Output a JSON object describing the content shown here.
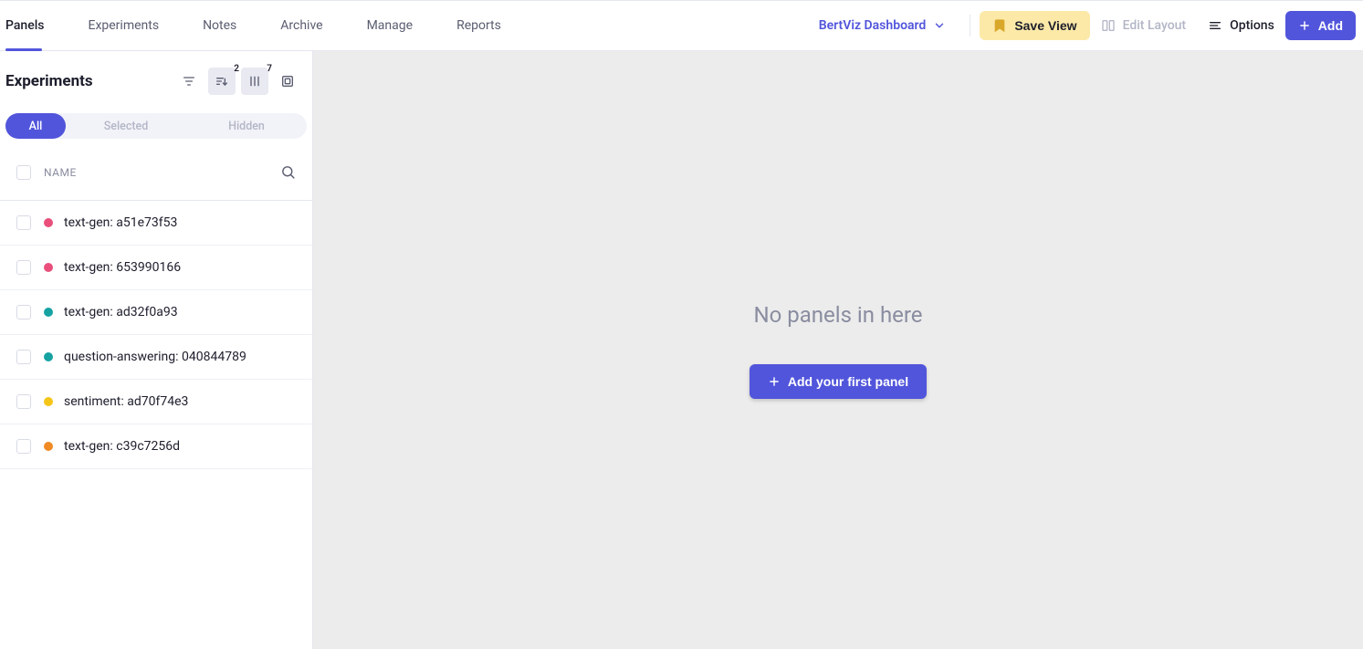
{
  "topnav": {
    "items": [
      {
        "label": "Panels",
        "id": "panels",
        "active": true
      },
      {
        "label": "Experiments",
        "id": "experiments",
        "active": false
      },
      {
        "label": "Notes",
        "id": "notes",
        "active": false
      },
      {
        "label": "Archive",
        "id": "archive",
        "active": false
      },
      {
        "label": "Manage",
        "id": "manage",
        "active": false
      },
      {
        "label": "Reports",
        "id": "reports",
        "active": false
      }
    ]
  },
  "dashboard": {
    "name": "BertViz Dashboard"
  },
  "actions": {
    "save_view": "Save View",
    "edit_layout": "Edit Layout",
    "options": "Options",
    "add": "Add"
  },
  "sidebar": {
    "title": "Experiments",
    "sort_badge": "2",
    "columns_badge": "7",
    "segments": {
      "all": "All",
      "selected": "Selected",
      "hidden": "Hidden"
    },
    "list_header": "NAME",
    "experiments": [
      {
        "name": "text-gen: a51e73f53",
        "color": "#e94f7a"
      },
      {
        "name": "text-gen: 653990166",
        "color": "#e94f7a"
      },
      {
        "name": "text-gen: ad32f0a93",
        "color": "#17a2a2"
      },
      {
        "name": "question-answering: 040844789",
        "color": "#17a2a2"
      },
      {
        "name": "sentiment: ad70f74e3",
        "color": "#f5c518"
      },
      {
        "name": "text-gen: c39c7256d",
        "color": "#f08a24"
      }
    ]
  },
  "main": {
    "empty_message": "No panels in here",
    "add_panel_button": "Add your first panel"
  }
}
